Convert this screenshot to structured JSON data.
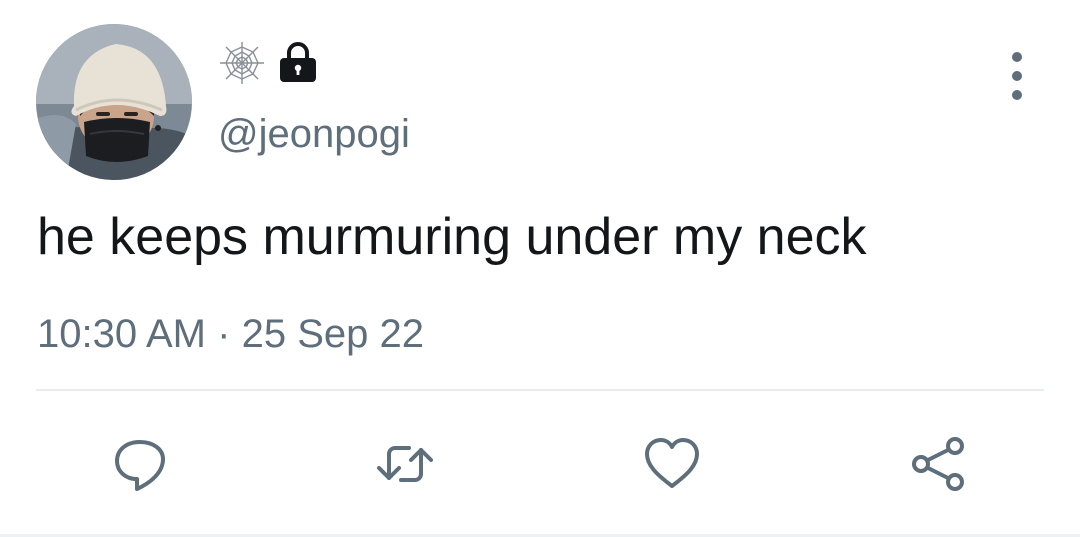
{
  "user": {
    "handle": "@jeonpogi",
    "avatar_icon": "avatar-photo-bucket-hat-mask",
    "badge_icon": "spider-web-icon",
    "protected_icon": "lock-icon"
  },
  "tweet": {
    "text": "he keeps murmuring under my neck",
    "time": "10:30 AM",
    "separator": "·",
    "date": "25 Sep 22"
  },
  "actions": [
    "reply-icon",
    "retweet-icon",
    "like-icon",
    "share-icon"
  ],
  "colors": {
    "text": "#14171a",
    "secondary": "#5f6e7b",
    "divider": "#e6ecf0",
    "background": "#ffffff"
  }
}
